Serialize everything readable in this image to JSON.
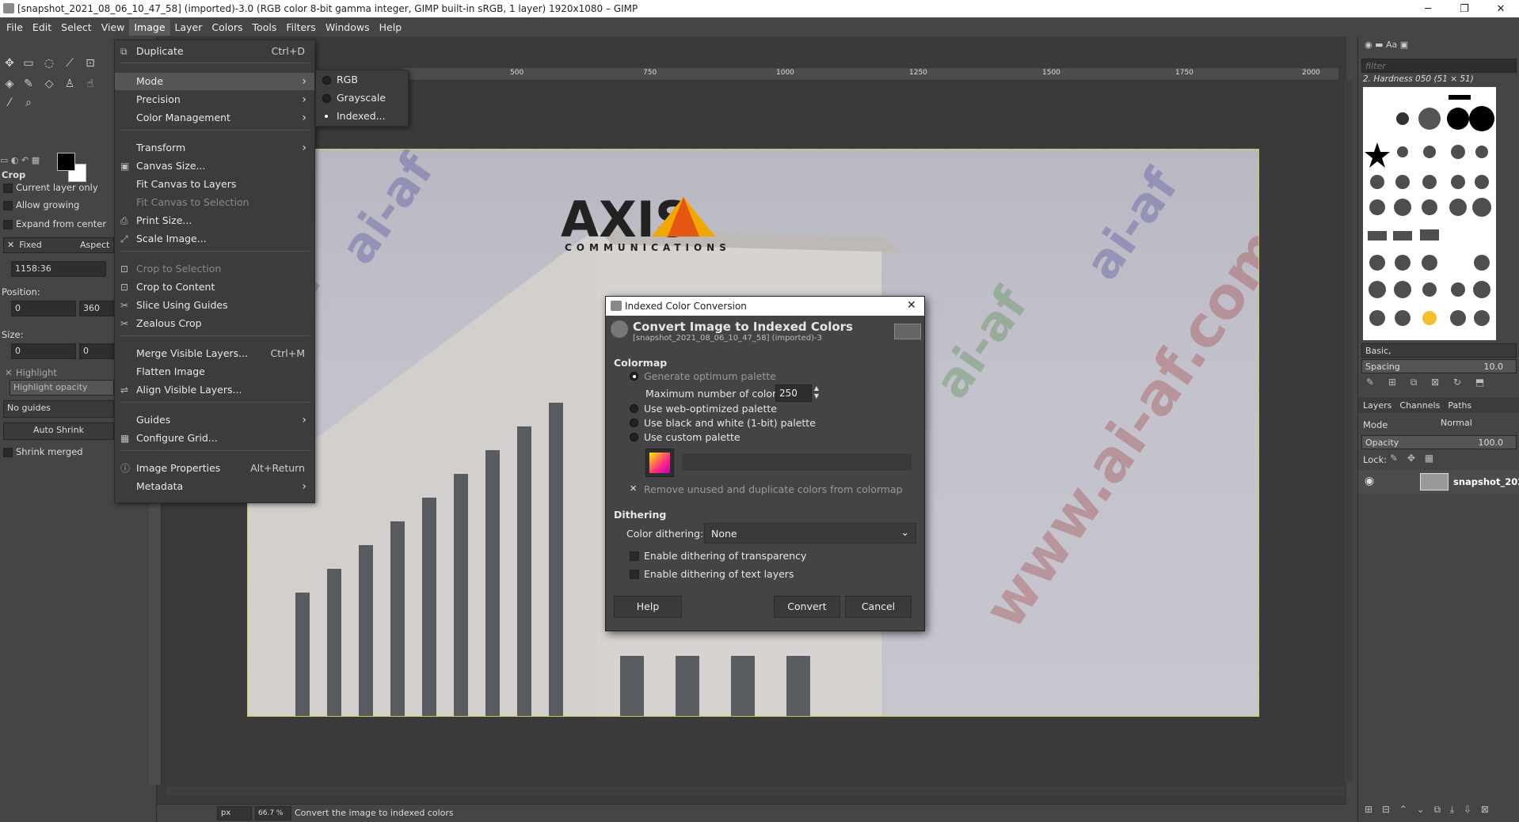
{
  "window": {
    "title": "[snapshot_2021_08_06_10_47_58] (imported)-3.0 (RGB color 8-bit gamma integer, GIMP built-in sRGB, 1 layer) 1920x1080 – GIMP",
    "minimize": "─",
    "maximize": "❐",
    "close": "✕"
  },
  "menubar": [
    "File",
    "Edit",
    "Select",
    "View",
    "Image",
    "Layer",
    "Colors",
    "Tools",
    "Filters",
    "Windows",
    "Help"
  ],
  "image_menu": {
    "duplicate": "Duplicate",
    "duplicate_sc": "Ctrl+D",
    "mode": "Mode",
    "precision": "Precision",
    "color_management": "Color Management",
    "transform": "Transform",
    "canvas_size": "Canvas Size...",
    "fit_canvas_layers": "Fit Canvas to Layers",
    "fit_canvas_selection": "Fit Canvas to Selection",
    "print_size": "Print Size...",
    "scale_image": "Scale Image...",
    "crop_selection": "Crop to Selection",
    "crop_content": "Crop to Content",
    "slice_guides": "Slice Using Guides",
    "zealous_crop": "Zealous Crop",
    "merge_visible": "Merge Visible Layers...",
    "merge_visible_sc": "Ctrl+M",
    "flatten": "Flatten Image",
    "align_visible": "Align Visible Layers...",
    "guides": "Guides",
    "configure_grid": "Configure Grid...",
    "image_properties": "Image Properties",
    "image_properties_sc": "Alt+Return",
    "metadata": "Metadata"
  },
  "mode_submenu": {
    "rgb": "RGB",
    "grayscale": "Grayscale",
    "indexed": "Indexed..."
  },
  "tool_options": {
    "tool": "Crop",
    "current_layer_only": "Current layer only",
    "allow_growing": "Allow growing",
    "expand_center": "Expand from center",
    "fixed": "Fixed",
    "aspect": "Aspect ra",
    "ratio": "1158:36",
    "position_label": "Position:",
    "pos_x": "0",
    "pos_y": "360",
    "size_label": "Size:",
    "size_w": "0",
    "size_h": "0",
    "highlight": "Highlight",
    "highlight_opacity": "Highlight opacity",
    "guides": "No guides",
    "auto_shrink": "Auto Shrink",
    "shrink_merged": "Shrink merged"
  },
  "rulers": {
    "top": [
      "500",
      "750",
      "1000",
      "1250",
      "1500",
      "1750",
      "2000"
    ]
  },
  "watermarks": [
    "ai-af",
    "ai-af",
    "ai-af",
    "ai-af",
    "ai-af",
    "ai-af",
    "www.ai-af.com"
  ],
  "logo": {
    "name": "AXIS",
    "sub": "COMMUNICATIONS"
  },
  "dialog": {
    "title": "Indexed Color Conversion",
    "heading": "Convert Image to Indexed Colors",
    "subheading": "[snapshot_2021_08_06_10_47_58] (imported)-3",
    "colormap": "Colormap",
    "generate_optimum": "Generate optimum palette",
    "max_colors_label": "Maximum number of colors:",
    "max_colors": "250",
    "web_palette": "Use web-optimized palette",
    "bw_palette": "Use black and white (1-bit) palette",
    "custom_palette": "Use custom palette",
    "remove_unused": "Remove unused and duplicate colors from colormap",
    "dithering": "Dithering",
    "color_dithering_label": "Color dithering:",
    "color_dithering": "None",
    "dither_transparency": "Enable dithering of transparency",
    "dither_text": "Enable dithering of text layers",
    "help": "Help",
    "convert": "Convert",
    "cancel": "Cancel"
  },
  "statusbar": {
    "unit": "px",
    "zoom": "66.7 %",
    "message": "Convert the image to indexed colors"
  },
  "right_dock": {
    "filter": "filter",
    "brush_name": "2. Hardness 050 (51 × 51)",
    "brush_set": "Basic,",
    "spacing_label": "Spacing",
    "spacing": "10.0",
    "tabs": [
      "Layers",
      "Channels",
      "Paths"
    ],
    "mode_label": "Mode",
    "mode": "Normal",
    "opacity_label": "Opacity",
    "opacity": "100.0",
    "lock_label": "Lock:",
    "layer_name": "snapshot_202"
  }
}
